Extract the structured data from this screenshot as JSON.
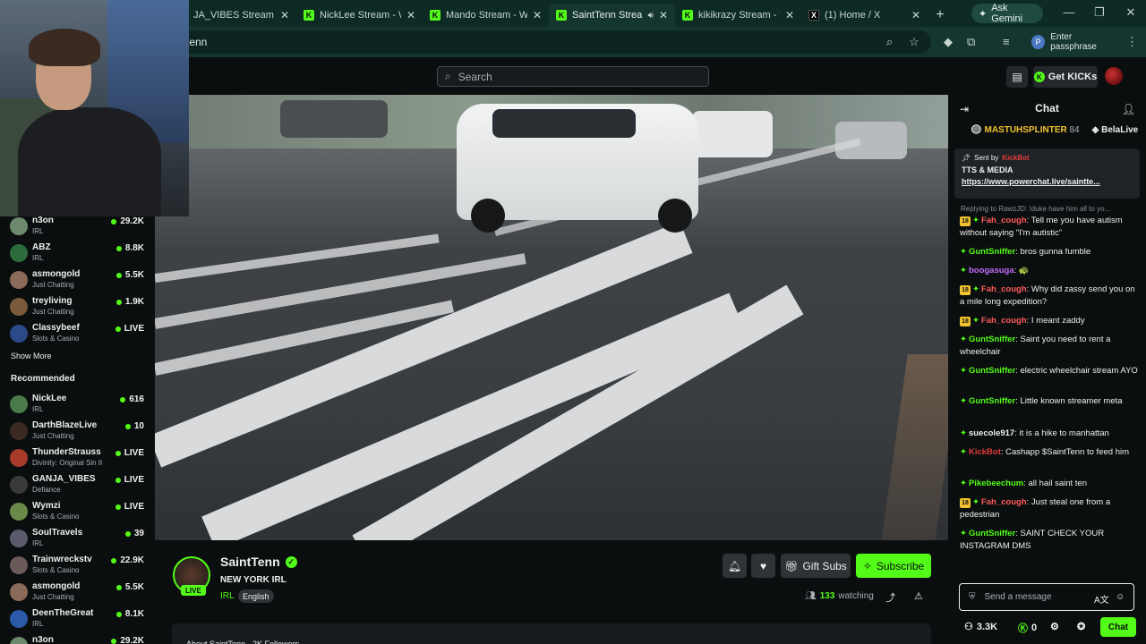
{
  "browser": {
    "tabs": [
      {
        "title": "JA_VIBES Stream - Watc",
        "fav": "K"
      },
      {
        "title": "NickLee Stream - Watc",
        "fav": "K"
      },
      {
        "title": "Mando Stream - Watc",
        "fav": "K"
      },
      {
        "title": "SaintTenn Stream",
        "fav": "K",
        "active": true
      },
      {
        "title": "kikikrazy Stream - Watc",
        "fav": "K"
      },
      {
        "title": "(1) Home / X",
        "fav": "X"
      }
    ],
    "ask_gemini": "Ask Gemini",
    "address": "tenn",
    "passphrase": "Enter passphrase",
    "passphrase_avatar": "P"
  },
  "header": {
    "search_placeholder": "Search",
    "get_kicks": "Get KICKs"
  },
  "sidebar": {
    "following": [
      {
        "name": "n3on",
        "category": "IRL",
        "viewers": "29.2K",
        "color": "#6e8a6e"
      },
      {
        "name": "ABZ",
        "category": "IRL",
        "viewers": "8.8K",
        "color": "#2d6b3d"
      },
      {
        "name": "asmongold",
        "category": "Just Chatting",
        "viewers": "5.5K",
        "color": "#8a6b5a"
      },
      {
        "name": "treyliving",
        "category": "Just Chatting",
        "viewers": "1.9K",
        "color": "#7a5a3a"
      },
      {
        "name": "Classybeef",
        "category": "Slots & Casino",
        "viewers": "LIVE",
        "color": "#2a4a8a"
      }
    ],
    "show_more": "Show More",
    "recommended_title": "Recommended",
    "recommended": [
      {
        "name": "NickLee",
        "category": "IRL",
        "viewers": "616",
        "color": "#4a7a4a"
      },
      {
        "name": "DarthBlazeLive",
        "category": "Just Chatting",
        "viewers": "10",
        "color": "#3a2a22"
      },
      {
        "name": "ThunderStrauss",
        "category": "Divinity: Original Sin II",
        "viewers": "LIVE",
        "color": "#a83a2a"
      },
      {
        "name": "GANJA_VIBES",
        "category": "Defiance",
        "viewers": "LIVE",
        "color": "#3a3a3a"
      },
      {
        "name": "Wymzi",
        "category": "Slots & Casino",
        "viewers": "LIVE",
        "color": "#6a8a4a"
      },
      {
        "name": "SoulTravels",
        "category": "IRL",
        "viewers": "39",
        "color": "#5a5a6a"
      },
      {
        "name": "Trainwreckstv",
        "category": "Slots & Casino",
        "viewers": "22.9K",
        "color": "#6a5a5a"
      },
      {
        "name": "asmongold",
        "category": "Just Chatting",
        "viewers": "5.5K",
        "color": "#8a6b5a"
      },
      {
        "name": "DeenTheGreat",
        "category": "IRL",
        "viewers": "8.1K",
        "color": "#2a5aa8"
      },
      {
        "name": "n3on",
        "category": "",
        "viewers": "29.2K",
        "color": "#6e8a6e"
      }
    ]
  },
  "stream": {
    "name": "SaintTenn",
    "live": "LIVE",
    "title": "NEW YORK IRL",
    "category": "IRL",
    "tag": "English",
    "gift_subs": "Gift Subs",
    "subscribe": "Subscribe",
    "watching_count": "133",
    "watching_label": "watching",
    "about": "About SaintTenn · 2K Followers"
  },
  "chat": {
    "title": "Chat",
    "top_gifters": [
      {
        "name": "MASTUHSPLINTER",
        "count": "84"
      },
      {
        "name": "BelaLive",
        "count": ""
      }
    ],
    "pinned": {
      "sent_by": "Sent by",
      "sender": "KickBot",
      "text": "TTS & MEDIA",
      "link": "https://www.powerchat.live/saintte..."
    },
    "reply_preview": "Replying to RawzJD: !duke have him all to yo...",
    "messages": [
      {
        "badge": "18",
        "user": "Fah_cough",
        "color": "#ff5a5a",
        "text": "Tell me you have autism without saying \"I'm autistic\""
      },
      {
        "badge": "",
        "user": "GuntSniffer",
        "color": "#53fc18",
        "text": "bros gunna fumble"
      },
      {
        "badge": "",
        "user": "boogasuga",
        "color": "#c26bff",
        "text": "🐢"
      },
      {
        "badge": "18",
        "user": "Fah_cough",
        "color": "#ff5a5a",
        "text": "Why did zassy send you on a mile long expedition?"
      },
      {
        "badge": "18",
        "user": "Fah_cough",
        "color": "#ff5a5a",
        "text": "I meant zaddy"
      },
      {
        "badge": "",
        "user": "GuntSniffer",
        "color": "#53fc18",
        "text": "Saint you need to rent a wheelchair"
      },
      {
        "badge": "",
        "user": "GuntSniffer",
        "color": "#53fc18",
        "text": "electric wheelchair stream AYO"
      },
      {
        "badge": "",
        "user": "GuntSniffer",
        "color": "#53fc18",
        "text": "Little known streamer meta"
      },
      {
        "badge": "",
        "user": "suecole917",
        "color": "#efeff1",
        "text": "it is a hike to manhattan"
      },
      {
        "badge": "",
        "user": "KickBot",
        "color": "#e23b3b",
        "text": "Cashapp $SaintTenn to feed him"
      },
      {
        "badge": "",
        "user": "Pikebeechum",
        "color": "#53fc18",
        "text": "all hail saint ten"
      },
      {
        "badge": "18",
        "user": "Fah_cough",
        "color": "#ff5a5a",
        "text": "Just steal one from a pedestrian"
      },
      {
        "badge": "",
        "user": "GuntSniffer",
        "color": "#53fc18",
        "text": "SAINT CHECK YOUR INSTAGRAM DMS"
      }
    ],
    "input_placeholder": "Send a message",
    "footer_viewers": "3.3K",
    "footer_kicks": "0",
    "chat_button": "Chat"
  }
}
